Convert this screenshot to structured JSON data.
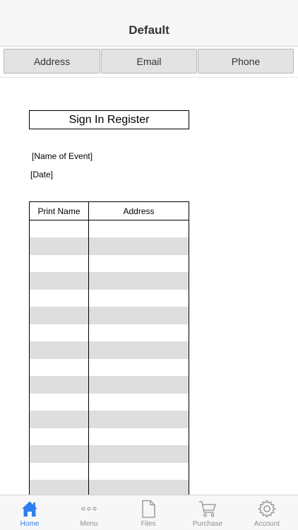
{
  "header": {
    "title": "Default"
  },
  "segments": [
    {
      "label": "Address"
    },
    {
      "label": "Email"
    },
    {
      "label": "Phone"
    }
  ],
  "document": {
    "title": "Sign In Register",
    "event_name": "[Name of Event]",
    "date": "[Date]",
    "columns": [
      "Print Name",
      "Address"
    ]
  },
  "tabs": [
    {
      "label": "Home",
      "icon": "home-icon",
      "active": true
    },
    {
      "label": "Menu",
      "icon": "more-dots-icon"
    },
    {
      "label": "Files",
      "icon": "file-icon"
    },
    {
      "label": "Purchase",
      "icon": "cart-icon"
    },
    {
      "label": "Account",
      "icon": "gear-icon"
    }
  ],
  "colors": {
    "accent": "#2f7ff0",
    "inactive": "#8e8e8e",
    "stripe": "#dedede"
  }
}
